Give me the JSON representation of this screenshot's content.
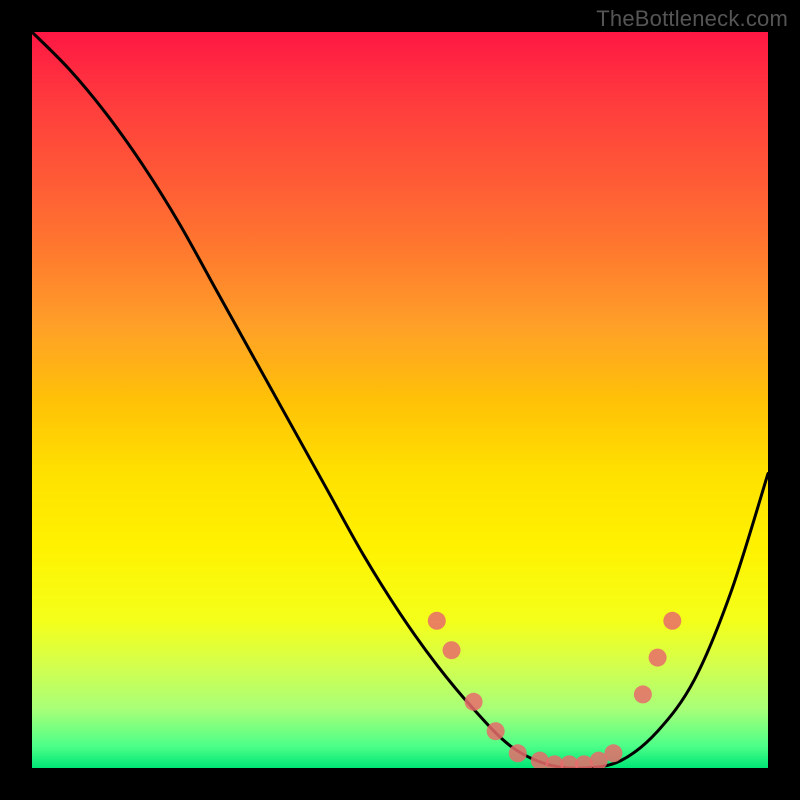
{
  "watermark": "TheBottleneck.com",
  "chart_data": {
    "type": "line",
    "title": "",
    "xlabel": "",
    "ylabel": "",
    "xlim": [
      0,
      100
    ],
    "ylim": [
      0,
      100
    ],
    "series": [
      {
        "name": "curve",
        "x": [
          0,
          5,
          10,
          15,
          20,
          25,
          30,
          35,
          40,
          45,
          50,
          55,
          60,
          65,
          70,
          75,
          80,
          85,
          90,
          95,
          100
        ],
        "y": [
          100,
          95,
          89,
          82,
          74,
          65,
          56,
          47,
          38,
          29,
          21,
          14,
          8,
          3,
          0.5,
          0,
          1,
          5,
          12,
          24,
          40
        ]
      }
    ],
    "markers": {
      "name": "dots",
      "x": [
        55,
        57,
        60,
        63,
        66,
        69,
        71,
        73,
        75,
        77,
        79,
        83,
        85,
        87
      ],
      "y": [
        20,
        16,
        9,
        5,
        2,
        1,
        0.5,
        0.5,
        0.5,
        1,
        2,
        10,
        15,
        20
      ]
    },
    "gradient_stops": [
      {
        "pos": 0.0,
        "color": "#ff1744"
      },
      {
        "pos": 0.5,
        "color": "#ffc107"
      },
      {
        "pos": 0.8,
        "color": "#f4ff1a"
      },
      {
        "pos": 1.0,
        "color": "#00e676"
      }
    ]
  }
}
